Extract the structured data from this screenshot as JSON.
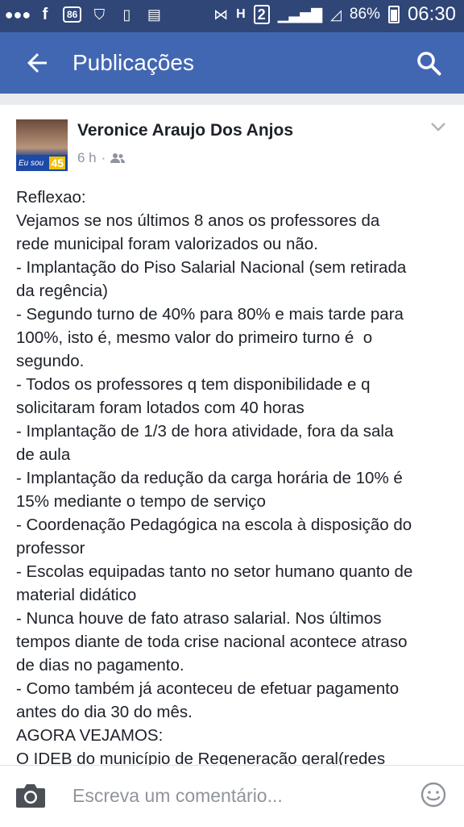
{
  "status_bar": {
    "icons": [
      "messenger-icon",
      "facebook-icon",
      "keyboard-86-icon",
      "shield-icon",
      "sim-icon",
      "clipboard-icon",
      "nfc-icon",
      "hplus-icon",
      "sim2-icon",
      "signal-icon",
      "signal2-icon",
      "battery-icon"
    ],
    "badge_86": "86",
    "h_label": "H",
    "sim2_label": "2",
    "battery_percent": "86%",
    "time": "06:30"
  },
  "app_bar": {
    "title": "Publicações"
  },
  "post": {
    "author": "Veronice Araujo Dos Anjos",
    "time_ago": "6 h",
    "separator": "·",
    "avatar_text_1": "Eu sou",
    "avatar_text_2": "45",
    "lines": [
      "Reflexao:",
      "Vejamos se nos últimos 8 anos os professores da",
      "rede municipal foram valorizados ou não.",
      "- Implantação do Piso Salarial Nacional (sem retirada",
      "da regência)",
      "- Segundo turno de 40% para 80% e mais tarde para",
      "100%, isto é, mesmo valor do primeiro turno é  o",
      "segundo.",
      "- Todos os professores q tem disponibilidade e q",
      "solicitaram foram lotados com 40 horas",
      "- Implantação de 1/3 de hora atividade, fora da sala",
      "de aula",
      "- Implantação da redução da carga horária de 10% é",
      "15% mediante o tempo de serviço",
      "- Coordenação Pedagógica na escola à disposição do",
      "professor",
      "- Escolas equipadas tanto no setor humano quanto de",
      "material didático",
      "- Nunca houve de fato atraso salarial. Nos últimos",
      "tempos diante de toda crise nacional acontece atraso",
      "de dias no pagamento.",
      "- Como também já aconteceu de efetuar pagamento",
      "antes do dia 30 do mês.",
      "AGORA VEJAMOS:",
      "O IDEB do município de Regeneração geral(redes"
    ]
  },
  "composer": {
    "placeholder": "Escreva um comentário..."
  },
  "colors": {
    "status_bar": "#2f4677",
    "app_bar": "#4267b2",
    "text": "#1d2129",
    "muted": "#90949c"
  }
}
